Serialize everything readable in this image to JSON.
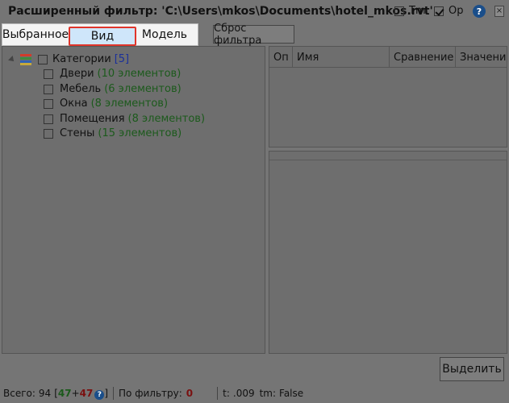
{
  "window": {
    "title": "Расширенный фильтр: 'C:\\Users\\mkos\\Documents\\hotel_mkos.rvt'",
    "opt_tm_label": "Tm",
    "opt_tm_checked": false,
    "opt_op_label": "Op",
    "opt_op_checked": true,
    "help_glyph": "?",
    "close_glyph": "×"
  },
  "modes": {
    "selected": "Выбранное",
    "view": "Вид",
    "model": "Модель",
    "active": "view"
  },
  "reset_label": "Сброс фильтра",
  "tree": {
    "root": {
      "label": "Категории",
      "count": "[5]"
    },
    "items": [
      {
        "label": "Двери",
        "count": "(10 элементов)"
      },
      {
        "label": "Мебель",
        "count": "(6 элементов)"
      },
      {
        "label": "Окна",
        "count": "(8 элементов)"
      },
      {
        "label": "Помещения",
        "count": "(8 элементов)"
      },
      {
        "label": "Стены",
        "count": "(15 элементов)"
      }
    ]
  },
  "grid": {
    "columns": [
      "Оп",
      "Имя",
      "Сравнение",
      "Значени"
    ]
  },
  "select_label": "Выделить",
  "status": {
    "total_label": "Всего:",
    "total": "94",
    "left_num": "47",
    "plus": "+",
    "right_num": "47",
    "help_glyph": "?",
    "byfilter_label": "По фильтру:",
    "byfilter_value": "0",
    "t_label": "t:",
    "t_value": ".009",
    "tm_label": "tm:",
    "tm_value": "False"
  }
}
